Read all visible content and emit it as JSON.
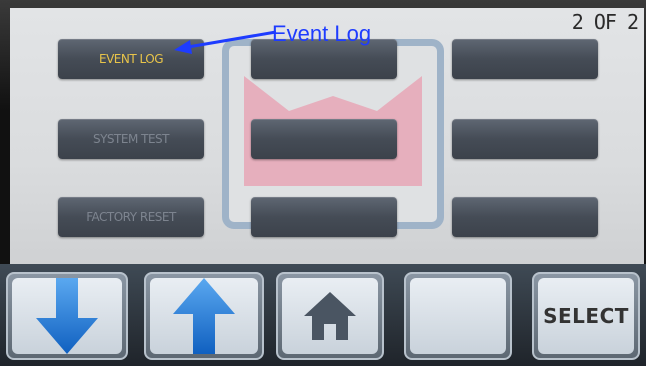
{
  "screen": {
    "page_indicator": "2 OF 2",
    "annotation": "Event Log"
  },
  "menu": {
    "left": [
      {
        "label": "EVENT LOG",
        "active": true
      },
      {
        "label": "SYSTEM TEST",
        "active": false
      },
      {
        "label": "FACTORY RESET",
        "active": false
      }
    ],
    "middle": [
      {
        "label": ""
      },
      {
        "label": ""
      },
      {
        "label": ""
      }
    ],
    "right": [
      {
        "label": ""
      },
      {
        "label": ""
      },
      {
        "label": ""
      }
    ]
  },
  "nav": {
    "down_icon": "arrow-down-icon",
    "up_icon": "arrow-up-icon",
    "home_icon": "home-icon",
    "blank_label": "",
    "select_label": "SELECT"
  },
  "colors": {
    "active_label": "#e8c44a",
    "arrow_blue": "#1e78d8",
    "annotation_blue": "#1e3cff",
    "logo_pink": "#e8a6b6"
  }
}
